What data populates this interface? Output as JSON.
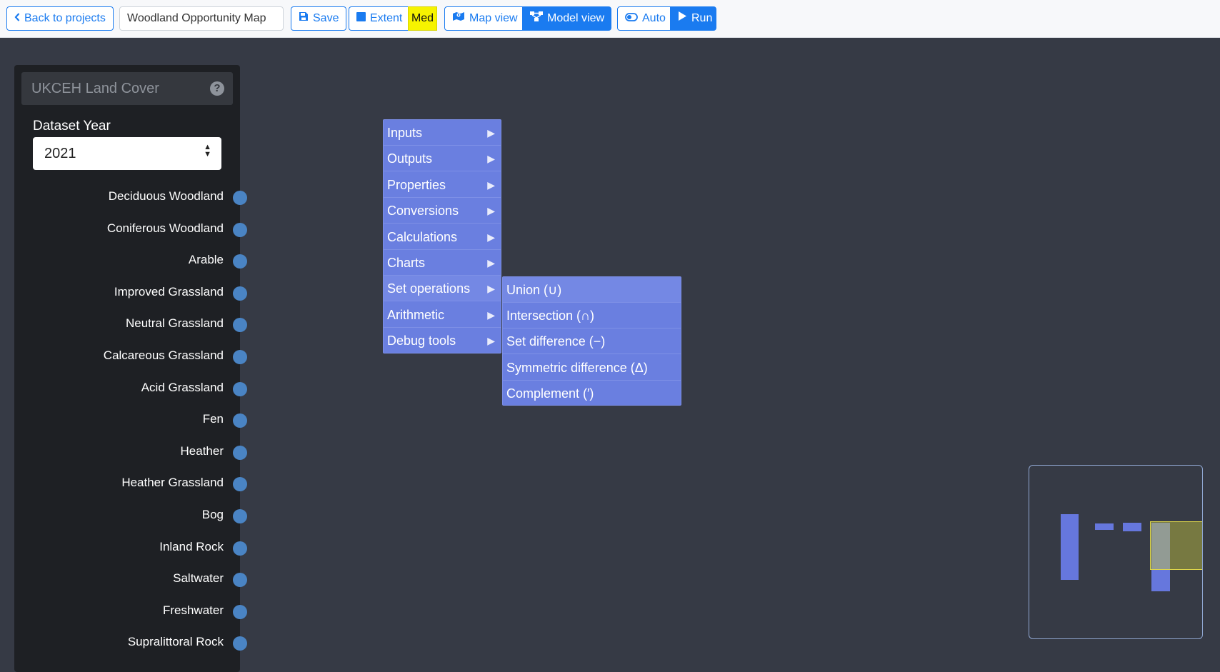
{
  "toolbar": {
    "back_label": "Back to projects",
    "project_title": "Woodland Opportunity Map",
    "save_label": "Save",
    "extent_label": "Extent",
    "resolution_badge": "Med",
    "map_view_label": "Map view",
    "model_view_label": "Model view",
    "auto_label": "Auto",
    "run_label": "Run"
  },
  "node": {
    "title": "UKCEH Land Cover",
    "field_label": "Dataset Year",
    "dataset_year": "2021",
    "outputs": [
      "Deciduous Woodland",
      "Coniferous Woodland",
      "Arable",
      "Improved Grassland",
      "Neutral Grassland",
      "Calcareous Grassland",
      "Acid Grassland",
      "Fen",
      "Heather",
      "Heather Grassland",
      "Bog",
      "Inland Rock",
      "Saltwater",
      "Freshwater",
      "Supralittoral Rock"
    ]
  },
  "context_menu": {
    "items": [
      "Inputs",
      "Outputs",
      "Properties",
      "Conversions",
      "Calculations",
      "Charts",
      "Set operations",
      "Arithmetic",
      "Debug tools"
    ],
    "active_item": "Set operations",
    "submenu": [
      "Union (∪)",
      "Intersection (∩)",
      "Set difference (−)",
      "Symmetric difference (Δ)",
      "Complement (′)"
    ]
  },
  "colors": {
    "accent": "#1a7bf0",
    "canvas": "#363a45",
    "menu": "#6a7fe0",
    "badge": "#f6f300",
    "socket": "#4a84c4"
  }
}
